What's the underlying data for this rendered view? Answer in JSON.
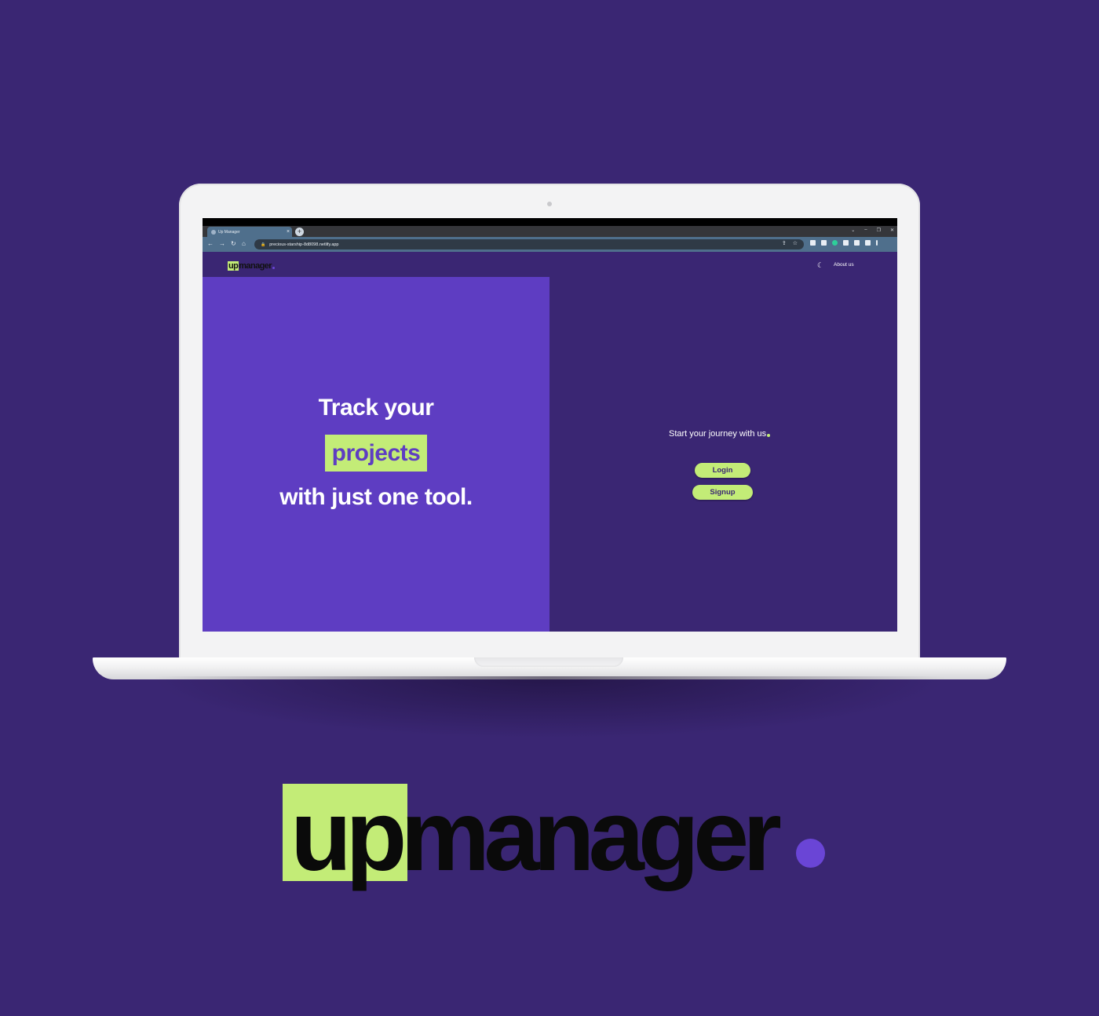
{
  "browser": {
    "tab_title": "Up Manager",
    "tab_close": "×",
    "new_tab": "+",
    "url": "precious-starship-8d8098.netlify.app"
  },
  "site": {
    "logo_highlight": "up",
    "logo_rest": "manager",
    "nav": {
      "about_label": "About us",
      "theme_icon": "moon-icon"
    },
    "hero": {
      "line1": "Track your",
      "line2": "projects",
      "line3": "with just one tool."
    },
    "cta": {
      "tagline": "Start your journey with us",
      "login_label": "Login",
      "signup_label": "Signup"
    }
  },
  "brand": {
    "logo_highlight": "up",
    "logo_rest": "manager"
  },
  "colors": {
    "background": "#3a2673",
    "hero_panel": "#5e3dc2",
    "accent_green": "#c3ec77",
    "accent_purple": "#6a45d6"
  }
}
